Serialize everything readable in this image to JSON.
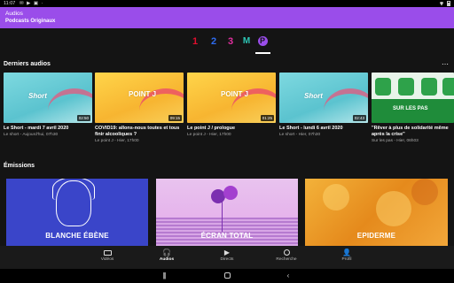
{
  "status_bar": {
    "time": "11:07",
    "icons": "✉ ▶ ▣ ·"
  },
  "header": {
    "title": "Audios",
    "subtitle": "Podcasts Originaux"
  },
  "brand_tabs": [
    {
      "label": "1",
      "color": "#e10f2e"
    },
    {
      "label": "2",
      "color": "#2e6cf0"
    },
    {
      "label": "3",
      "color": "#e22fa0"
    },
    {
      "label": "M",
      "color": "#2dc6b5"
    },
    {
      "label": "P",
      "color": "#9a4dea",
      "selected": true
    }
  ],
  "recent_section": {
    "title": "Derniers audios",
    "more_icon": "⋯"
  },
  "episodes": [
    {
      "logo": "Short",
      "duration": "02:50",
      "title": "Le Short - mardi 7 avril 2020",
      "meta": "Le short - Aujourd'hui, 07h30"
    },
    {
      "logo": "POINT J",
      "duration": "09:15",
      "title": "COVID19: allons-nous toutes et tous finir alcooliques ?",
      "meta": "Le point J - Hier, 17h00"
    },
    {
      "logo": "POINT J",
      "duration": "01:25",
      "title": "Le point J / prologue",
      "meta": "Le point J - Hier, 17h00"
    },
    {
      "logo": "Short",
      "duration": "02:43",
      "title": "Le Short - lundi 6 avril 2020",
      "meta": "Le short - Hier, 07h30"
    },
    {
      "logo": "SUR LES PAS",
      "duration": "",
      "title": "\"Rêver à plus de solidarité même après la crise\"",
      "meta": "Sur les pas - Hier, 06h03"
    }
  ],
  "shows_section": {
    "title": "Émissions"
  },
  "shows": [
    {
      "label": "BLANCHE ÉBÈNE"
    },
    {
      "label": "ÉCRAN TOTAL"
    },
    {
      "label": "EPIDERME"
    }
  ],
  "bottom_nav": [
    {
      "label": "Vidéos",
      "icon": "tv-icon"
    },
    {
      "label": "Audios",
      "icon": "headphones-icon",
      "active": true
    },
    {
      "label": "Directs",
      "icon": "play-icon"
    },
    {
      "label": "Recherche",
      "icon": "search-icon"
    },
    {
      "label": "Profil",
      "icon": "person-icon"
    }
  ],
  "system_nav": {
    "recent": "|||",
    "home": "",
    "back": "‹"
  }
}
